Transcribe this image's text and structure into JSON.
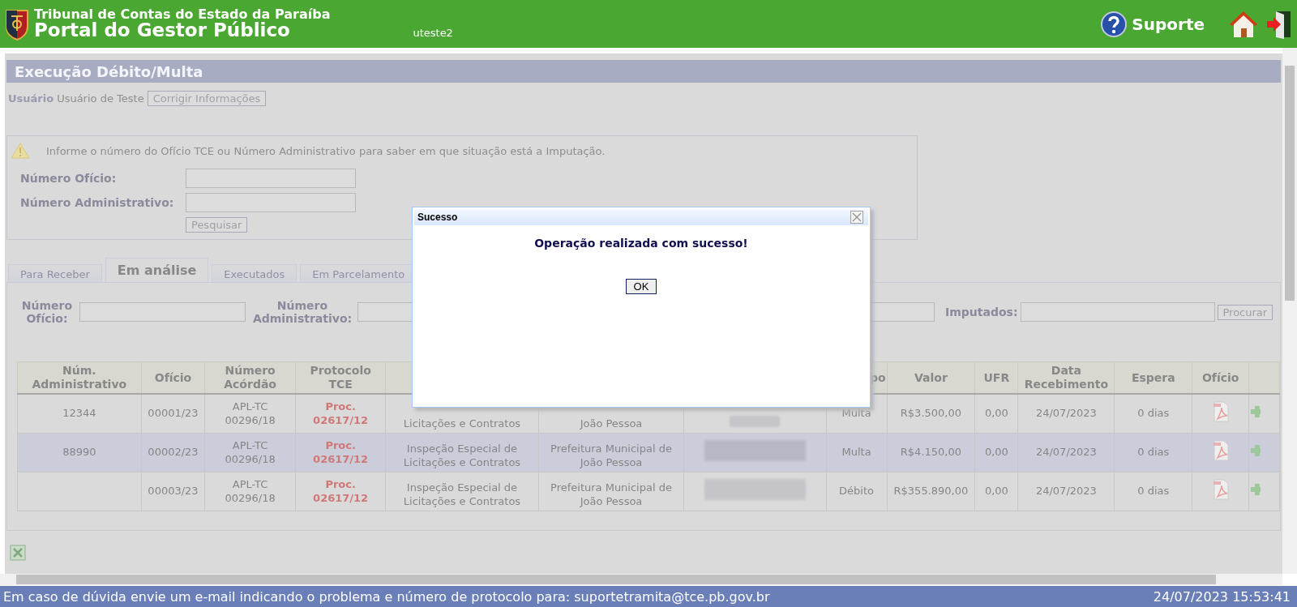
{
  "header": {
    "org": "Tribunal de Contas do Estado da Paraíba",
    "portal": "Portal do Gestor Público",
    "user": "uteste2",
    "support": "Suporte"
  },
  "page": {
    "title": "Execução Débito/Multa",
    "user_label": "Usuário",
    "user_name": "Usuário de Teste",
    "fix_button": "Corrigir Informações"
  },
  "search_box": {
    "message": "Informe o número do Ofício TCE ou Número Administrativo para saber em que situação está a Imputação.",
    "fields": [
      {
        "label": "Número Ofício:"
      },
      {
        "label": "Número Administrativo:"
      }
    ],
    "button": "Pesquisar"
  },
  "tabs": [
    {
      "label": "Para Receber",
      "selected": false
    },
    {
      "label": "Em análise",
      "selected": true
    },
    {
      "label": "Executados",
      "selected": false
    },
    {
      "label": "Em Parcelamento",
      "selected": false
    }
  ],
  "filters": {
    "oficio_label": "Número Ofício:",
    "admin_label": "Número Administrativo:",
    "imputados_label": "Imputados:",
    "button": "Procurar"
  },
  "table": {
    "columns_left": [
      "Núm. Administrativo",
      "Ofício",
      "Número Acórdão",
      "Protocolo TCE"
    ],
    "columns_right": [
      "po",
      "Valor",
      "UFR",
      "Data Recebimento",
      "Espera",
      "Ofício"
    ],
    "rows": [
      {
        "selected": false,
        "num_adm": "12344",
        "oficio": "00001/23",
        "acordao": "APL-TC\n00296/18",
        "protocolo": "Proc.\n02617/12",
        "column_5": "Licitações e Contratos",
        "column_6": "João Pessoa",
        "tipo": "Multa",
        "valor": "R$3.500,00",
        "ufr": "0,00",
        "data": "24/07/2023",
        "espera": "0 dias"
      },
      {
        "selected": true,
        "num_adm": "88990",
        "oficio": "00002/23",
        "acordao": "APL-TC\n00296/18",
        "protocolo": "Proc.\n02617/12",
        "column_5": "Inspeção Especial de\nLicitações e Contratos",
        "column_6": "Prefeitura Municipal de\nJoão Pessoa",
        "tipo": "Multa",
        "valor": "R$4.150,00",
        "ufr": "0,00",
        "data": "24/07/2023",
        "espera": "0 dias"
      },
      {
        "selected": false,
        "oficio": "00003/23",
        "acordao": "APL-TC\n00296/18",
        "protocolo": "Proc.\n02617/12",
        "column_5": "Inspeção Especial de\nLicitações e Contratos",
        "column_6": "Prefeitura Municipal de\nJoão Pessoa",
        "tipo": "Débito",
        "valor": "R$355.890,00",
        "ufr": "0,00",
        "data": "24/07/2023",
        "espera": "0 dias"
      }
    ]
  },
  "dialog": {
    "title": "Sucesso",
    "message": "Operação realizada com sucesso!",
    "button": "OK"
  },
  "status_bar": {
    "message": "Em caso de dúvida envie um e-mail indicando o problema e número de protocolo para: suportetramita@tce.pb.gov.br",
    "datetime": "24/07/2023 15:53:41"
  }
}
